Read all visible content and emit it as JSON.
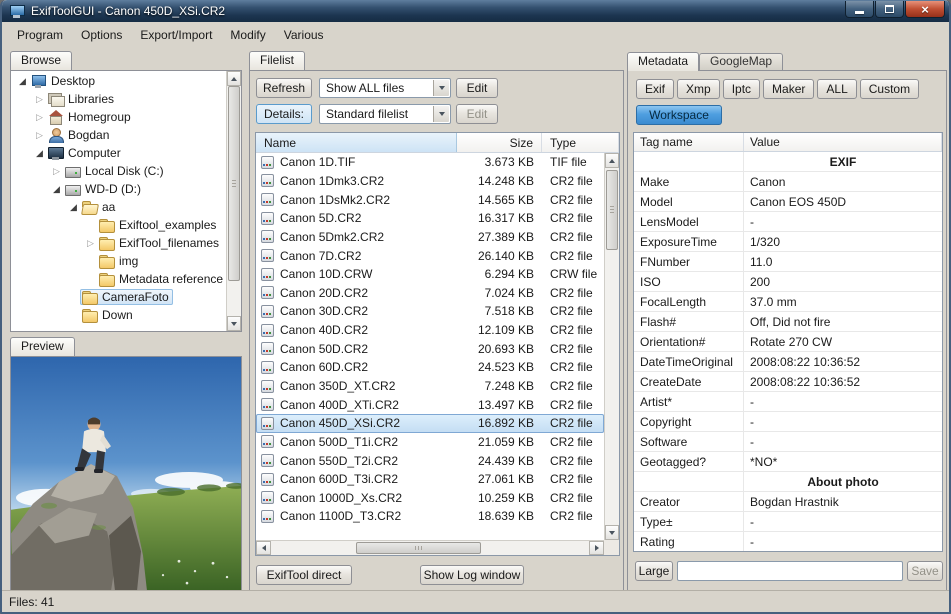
{
  "window": {
    "title": "ExifToolGUI - Canon 450D_XSi.CR2"
  },
  "menu": {
    "items": [
      {
        "label": "Program"
      },
      {
        "label": "Options"
      },
      {
        "label": "Export/Import"
      },
      {
        "label": "Modify"
      },
      {
        "label": "Various"
      }
    ]
  },
  "browse": {
    "tab_label": "Browse",
    "preview_tab_label": "Preview",
    "tree": [
      {
        "label": "Desktop",
        "level": 0,
        "icon": "desktop",
        "arrow": "expanded"
      },
      {
        "label": "Libraries",
        "level": 1,
        "icon": "libraries",
        "arrow": "collapsed"
      },
      {
        "label": "Homegroup",
        "level": 1,
        "icon": "homegroup",
        "arrow": "collapsed"
      },
      {
        "label": "Bogdan",
        "level": 1,
        "icon": "user",
        "arrow": "collapsed"
      },
      {
        "label": "Computer",
        "level": 1,
        "icon": "computer",
        "arrow": "expanded"
      },
      {
        "label": "Local Disk (C:)",
        "level": 2,
        "icon": "disk",
        "arrow": "collapsed"
      },
      {
        "label": "WD-D (D:)",
        "level": 2,
        "icon": "disk",
        "arrow": "expanded"
      },
      {
        "label": "aa",
        "level": 3,
        "icon": "folder-open",
        "arrow": "expanded"
      },
      {
        "label": "Exiftool_examples",
        "level": 4,
        "icon": "folder"
      },
      {
        "label": "ExifTool_filenames",
        "level": 4,
        "icon": "folder",
        "arrow": "collapsed"
      },
      {
        "label": "img",
        "level": 4,
        "icon": "folder"
      },
      {
        "label": "Metadata reference",
        "level": 4,
        "icon": "folder"
      },
      {
        "label": "CameraFoto",
        "level": 3,
        "icon": "folder",
        "selected": true
      },
      {
        "label": "Down",
        "level": 3,
        "icon": "folder"
      }
    ]
  },
  "filelist": {
    "tab_label": "Filelist",
    "refresh_label": "Refresh",
    "filter_value": "Show ALL files",
    "edit_label": "Edit",
    "details_label": "Details:",
    "list_type_value": "Standard filelist",
    "edit2_label": "Edit",
    "columns": [
      "Name",
      "Size",
      "Type"
    ],
    "file_icon": "raw-file-icon",
    "rows": [
      {
        "name": "Canon 1D.TIF",
        "size": "3.673 KB",
        "type": "TIF file"
      },
      {
        "name": "Canon 1Dmk3.CR2",
        "size": "14.248 KB",
        "type": "CR2 file"
      },
      {
        "name": "Canon 1DsMk2.CR2",
        "size": "14.565 KB",
        "type": "CR2 file"
      },
      {
        "name": "Canon 5D.CR2",
        "size": "16.317 KB",
        "type": "CR2 file"
      },
      {
        "name": "Canon 5Dmk2.CR2",
        "size": "27.389 KB",
        "type": "CR2 file"
      },
      {
        "name": "Canon 7D.CR2",
        "size": "26.140 KB",
        "type": "CR2 file"
      },
      {
        "name": "Canon 10D.CRW",
        "size": "6.294 KB",
        "type": "CRW file"
      },
      {
        "name": "Canon 20D.CR2",
        "size": "7.024 KB",
        "type": "CR2 file"
      },
      {
        "name": "Canon 30D.CR2",
        "size": "7.518 KB",
        "type": "CR2 file"
      },
      {
        "name": "Canon 40D.CR2",
        "size": "12.109 KB",
        "type": "CR2 file"
      },
      {
        "name": "Canon 50D.CR2",
        "size": "20.693 KB",
        "type": "CR2 file"
      },
      {
        "name": "Canon 60D.CR2",
        "size": "24.523 KB",
        "type": "CR2 file"
      },
      {
        "name": "Canon 350D_XT.CR2",
        "size": "7.248 KB",
        "type": "CR2 file"
      },
      {
        "name": "Canon 400D_XTi.CR2",
        "size": "13.497 KB",
        "type": "CR2 file"
      },
      {
        "name": "Canon 450D_XSi.CR2",
        "size": "16.892 KB",
        "type": "CR2 file",
        "selected": true
      },
      {
        "name": "Canon 500D_T1i.CR2",
        "size": "21.059 KB",
        "type": "CR2 file"
      },
      {
        "name": "Canon 550D_T2i.CR2",
        "size": "24.439 KB",
        "type": "CR2 file"
      },
      {
        "name": "Canon 600D_T3i.CR2",
        "size": "27.061 KB",
        "type": "CR2 file"
      },
      {
        "name": "Canon 1000D_Xs.CR2",
        "size": "10.259 KB",
        "type": "CR2 file"
      },
      {
        "name": "Canon 1100D_T3.CR2",
        "size": "18.639 KB",
        "type": "CR2 file"
      }
    ],
    "exiftool_direct_label": "ExifTool direct",
    "show_log_label": "Show Log window"
  },
  "metadata": {
    "tabs": [
      {
        "label": "Metadata",
        "active": true
      },
      {
        "label": "GoogleMap"
      }
    ],
    "filter_buttons": [
      {
        "label": "Exif"
      },
      {
        "label": "Xmp"
      },
      {
        "label": "Iptc"
      },
      {
        "label": "Maker"
      },
      {
        "label": "ALL"
      },
      {
        "label": "Custom"
      }
    ],
    "workspace_label": "Workspace",
    "columns": [
      "Tag name",
      "Value"
    ],
    "rows": [
      {
        "tag": "",
        "value": "EXIF",
        "section": true
      },
      {
        "tag": "Make",
        "value": "Canon"
      },
      {
        "tag": "Model",
        "value": "Canon EOS 450D"
      },
      {
        "tag": "LensModel",
        "value": "-"
      },
      {
        "tag": "ExposureTime",
        "value": "1/320"
      },
      {
        "tag": "FNumber",
        "value": "11.0"
      },
      {
        "tag": "ISO",
        "value": "200"
      },
      {
        "tag": "FocalLength",
        "value": "37.0 mm"
      },
      {
        "tag": "Flash#",
        "value": "Off, Did not fire"
      },
      {
        "tag": "Orientation#",
        "value": "Rotate 270 CW"
      },
      {
        "tag": "DateTimeOriginal",
        "value": "2008:08:22 10:36:52"
      },
      {
        "tag": "CreateDate",
        "value": "2008:08:22 10:36:52"
      },
      {
        "tag": "Artist*",
        "value": "-"
      },
      {
        "tag": "Copyright",
        "value": "-"
      },
      {
        "tag": "Software",
        "value": "-"
      },
      {
        "tag": "Geotagged?",
        "value": "*NO*"
      },
      {
        "tag": "",
        "value": "About photo",
        "section": true
      },
      {
        "tag": "Creator",
        "value": "Bogdan Hrastnik"
      },
      {
        "tag": "Type±",
        "value": "-"
      },
      {
        "tag": "Rating",
        "value": "-"
      }
    ],
    "large_label": "Large",
    "custom_tag_value": "",
    "save_label": "Save"
  },
  "statusbar": {
    "files_text": "Files: 41"
  },
  "colors": {
    "titlebar_blue": "#1c3550",
    "selection_blue": "#c3ddf3",
    "workspace_button_blue": "#4f9fe0"
  }
}
